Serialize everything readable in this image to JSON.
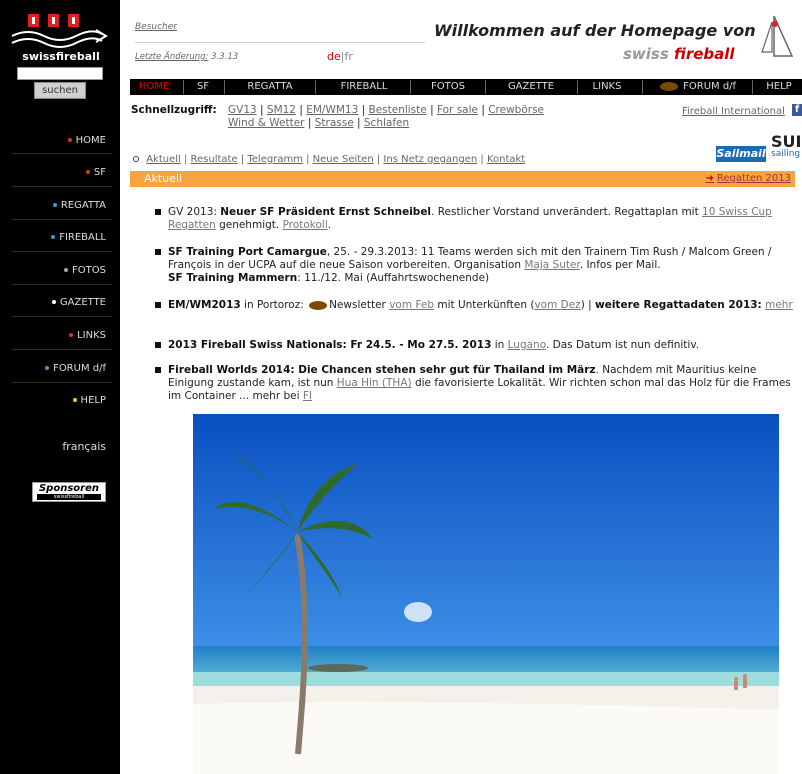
{
  "sidebar": {
    "search_button": "suchen",
    "items": [
      {
        "label": "HOME",
        "dot": "#e03030"
      },
      {
        "label": "SF",
        "dot": "#e03030"
      },
      {
        "label": "REGATTA",
        "dot": "#3a9ad9"
      },
      {
        "label": "FIREBALL",
        "dot": "#3a9ad9"
      },
      {
        "label": "FOTOS",
        "dot": "#aaaaaa"
      },
      {
        "label": "GAZETTE",
        "dot": "#ffffff"
      },
      {
        "label": "LINKS",
        "dot": "#e03030"
      },
      {
        "label": "FORUM d/f",
        "dot": "#3a9ad9"
      },
      {
        "label": "HELP",
        "dot": "#f0c020"
      }
    ],
    "language": "français",
    "sponsor_label": "Sponsoren",
    "sponsor_sub": "swissfireball",
    "logo_text": "swissfireball"
  },
  "header": {
    "visitors": "Besucher",
    "last_change_label": "Letzte Änderung:",
    "last_change_date": "3.3.13",
    "lang_de": "de",
    "lang_sep": "|",
    "lang_fr": "fr",
    "welcome": "Willkommen auf der Homepage von",
    "brand_prefix": "swiss",
    "brand_suffix": "fireball"
  },
  "nav": [
    {
      "label": "HOME",
      "active": true
    },
    {
      "label": "SF"
    },
    {
      "label": "REGATTA"
    },
    {
      "label": "FIREBALL"
    },
    {
      "label": "FOTOS"
    },
    {
      "label": "GAZETTE"
    },
    {
      "label": "LINKS"
    },
    {
      "label": "FORUM d/f"
    },
    {
      "label": "HELP"
    }
  ],
  "quick": {
    "label": "Schnellzugriff:",
    "line1": [
      "GV13",
      "SM12",
      "EM/WM13",
      "Bestenliste",
      "For sale",
      "Crewbörse"
    ],
    "line2": [
      "Wind & Wetter",
      "Strasse",
      "Schlafen"
    ],
    "fireball_international": "Fireball International",
    "fb_icon": "f"
  },
  "sponsor": {
    "sailmail": "Sailmail",
    "sui": "SUI",
    "sailing": "sailing"
  },
  "sublinks": [
    "Aktuell",
    "Resultate",
    "Telegramm",
    "Neue Seiten",
    "Ins Netz gegangen",
    "Kontakt"
  ],
  "aktuell": {
    "title": "Aktuell",
    "right_link": "Regatten 2013"
  },
  "news": {
    "n1": {
      "a": "GV 2013: ",
      "b": "Neuer SF Präsident Ernst Schneibel",
      "c": ". Restlicher Vorstand unverändert. Regattaplan mit ",
      "d": "10 Swiss Cup Regatten",
      "e": " genehmigt. ",
      "f": "Protokoll",
      "g": "."
    },
    "n2": {
      "a": "SF Training Port Camargue",
      "b": ", 25. - 29.3.2013: 11 Teams werden sich mit den Trainern Tim Rush / Malcom Green / François in der UCPA auf die neue Saison vorbereiten. Organisation ",
      "c": "Maja Suter",
      "d": ". Infos per Mail.",
      "e": "SF Training Mammern",
      "f": ": 11./12. Mai (Auffahrtswochenende)"
    },
    "n3": {
      "a": "EM/WM2013",
      "b": " in Portoroz: ",
      "c": "Newsletter ",
      "d": "vom Feb",
      "e": " mit Unterkünften (",
      "f": "vom Dez",
      "g": ") | ",
      "h": "weitere Regattadaten 2013:",
      "i": " ",
      "j": "mehr"
    },
    "n4": {
      "a": "2013 Fireball Swiss Nationals: Fr 24.5. - Mo 27.5. 2013",
      "b": " in ",
      "c": "Lugano",
      "d": ". Das Datum ist nun definitiv."
    },
    "n5": {
      "a": "Fireball Worlds 2014: Die Chancen stehen sehr gut für Thailand im März",
      "b": ". Nachdem mit Mauritius keine Einigung zustande kam, ist nun ",
      "c": "Hua Hin (THA)",
      "d": " die favorisierte Lokalität. Wir richten schon mal das Holz für die Frames im Container ... mehr bei ",
      "e": "FI"
    }
  }
}
